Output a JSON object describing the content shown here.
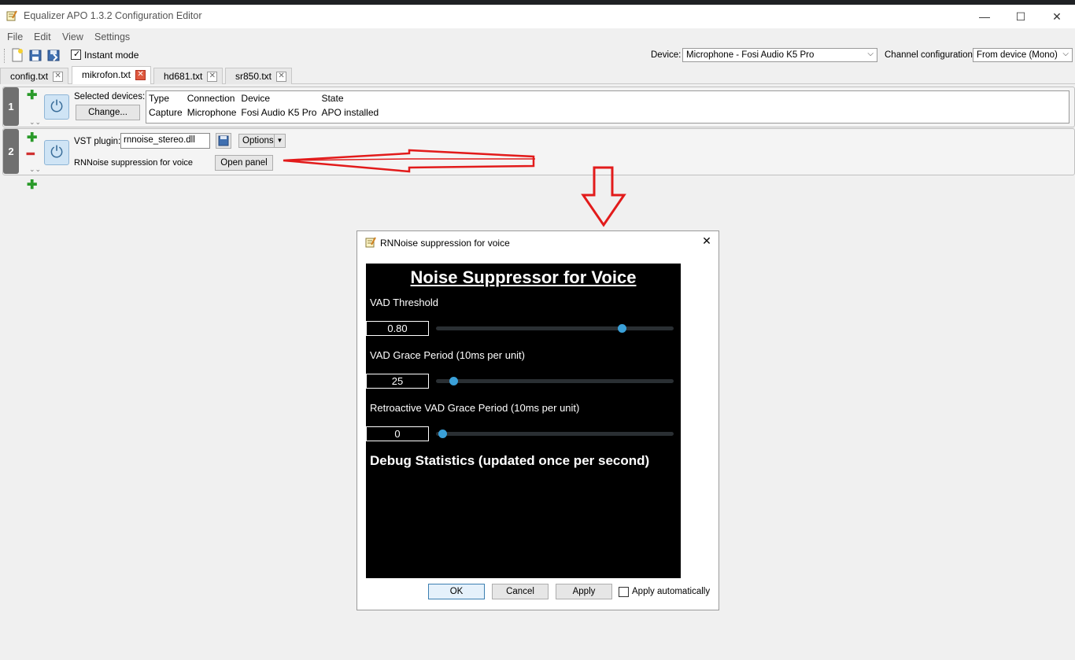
{
  "window": {
    "title": "Equalizer APO 1.3.2 Configuration Editor",
    "minimize": "—",
    "maximize": "☐",
    "close": "✕"
  },
  "menu": [
    "File",
    "Edit",
    "View",
    "Settings"
  ],
  "toolbar": {
    "instant_mode_label": "Instant mode",
    "instant_mode_checked": true,
    "device_label": "Device:",
    "device_value": "Microphone - Fosi Audio K5 Pro",
    "channel_label": "Channel configuration:",
    "channel_value": "From device (Mono)"
  },
  "tabs": [
    {
      "label": "config.txt",
      "active": false
    },
    {
      "label": "mikrofon.txt",
      "active": true
    },
    {
      "label": "hd681.txt",
      "active": false
    },
    {
      "label": "sr850.txt",
      "active": false
    }
  ],
  "rows": {
    "row1": {
      "number": "1",
      "selected_devices_label": "Selected devices:",
      "change_button": "Change...",
      "table_headers": [
        "Type",
        "Connection",
        "Device",
        "State"
      ],
      "table_values": [
        "Capture",
        "Microphone",
        "Fosi Audio K5 Pro",
        "APO installed"
      ]
    },
    "row2": {
      "number": "2",
      "vst_label": "VST plugin:",
      "vst_value": "rnnoise_stereo.dll",
      "options_button": "Options",
      "plugin_name": "RNNoise suppression for voice",
      "open_panel_button": "Open panel"
    }
  },
  "dialog": {
    "title": "RNNoise suppression for voice",
    "close": "✕",
    "plugin": {
      "heading": "Noise Suppressor for Voice",
      "params": [
        {
          "label": "VAD Threshold",
          "value": "0.80",
          "fraction": 0.795
        },
        {
          "label": "VAD Grace Period (10ms per unit)",
          "value": "25",
          "fraction": 0.06
        },
        {
          "label": "Retroactive VAD Grace Period (10ms per unit)",
          "value": "0",
          "fraction": 0.01
        }
      ],
      "debug_heading": "Debug Statistics (updated once per second)"
    },
    "buttons": {
      "ok": "OK",
      "cancel": "Cancel",
      "apply": "Apply",
      "apply_auto": "Apply automatically"
    }
  },
  "colors": {
    "annotation_red": "#e21b1b",
    "slider_knob": "#3aa0d8"
  }
}
